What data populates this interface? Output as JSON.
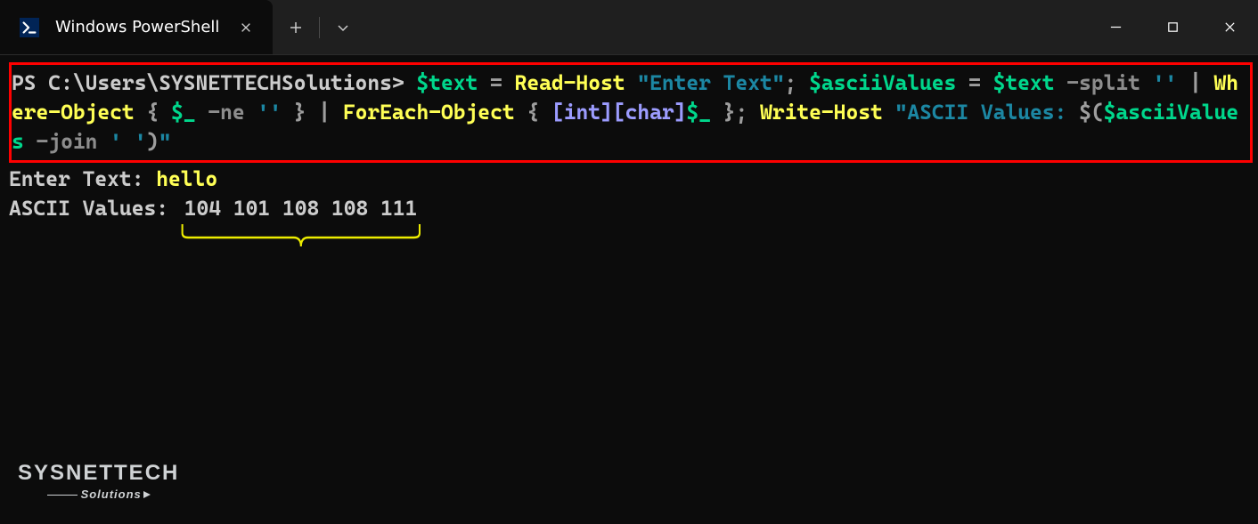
{
  "titlebar": {
    "tab_title": "Windows PowerShell"
  },
  "command": {
    "prompt": "PS C:\\Users\\SYSNETTECHSolutions> ",
    "s1_var_text": "$text",
    "s1_eq": " = ",
    "s1_readhost": "Read-Host",
    "s1_sp1": " ",
    "s1_str_enter": "\"Enter Text\"",
    "s1_semi": "; ",
    "s2_var_ascii": "$asciiValues",
    "s2_eq": " = ",
    "s2_var_text2": "$text",
    "s2_split": " -split ",
    "s2_splitarg": "''",
    "s2_pipe1": " | ",
    "s2_where": "Where-Object",
    "s2_sp2": " ",
    "s2_brace_o": "{ ",
    "s2_dollar": "$_",
    "s2_ne": " -ne ",
    "s2_ne_arg": "''",
    "s2_brace_c": " }",
    "s2_pipe2": " | ",
    "s2_foreach": "ForEach-Object",
    "s2_sp3": " ",
    "s2_brace_o2": "{ ",
    "s2_cast": "[int][char]",
    "s2_dollar2": "$_",
    "s2_brace_c2": " }",
    "s2_semi": "; ",
    "s3_write": "Write-Host",
    "s3_sp": " ",
    "s3_str_o": "\"ASCII Values: ",
    "s3_sub_o": "$(",
    "s3_var": "$asciiValues",
    "s3_join": " -join ",
    "s3_joinarg": "' '",
    "s3_sub_c": ")",
    "s3_str_c": "\""
  },
  "output": {
    "enter_text_label": "Enter Text: ",
    "user_input": "hello",
    "ascii_label": "ASCII Values: ",
    "ascii_values": "104 101 108 108 111"
  },
  "watermark": {
    "top": "SYSNETTECH",
    "bottom": "Solutions"
  }
}
